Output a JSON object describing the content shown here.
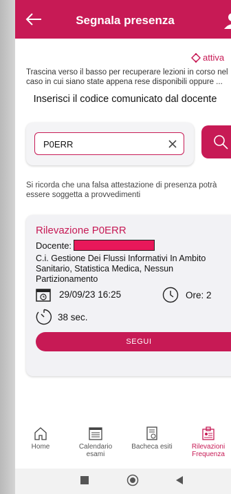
{
  "header": {
    "title": "Segnala presenza"
  },
  "attiva_label": "attiva",
  "info_line1": "Trascina verso il basso per recuperare lezioni in corso nel",
  "info_line2": "caso in cui siano state appena rese disponibili oppure ...",
  "code_heading": "Inserisci il codice comunicato dal docente",
  "search": {
    "value": "P0ERR"
  },
  "warning": "Si ricorda che una falsa attestazione di presenza potrà essere soggetta a provvedimenti",
  "card": {
    "title": "Rilevazione P0ERR",
    "docente_label": "Docente:",
    "course": "C.i. Gestione Dei Flussi Informativi In Ambito Sanitario, Statistica Medica, Nessun Partizionamento",
    "datetime": "29/09/23 16:25",
    "hours": "Ore: 2",
    "duration": "38 sec.",
    "button": "SEGUI"
  },
  "nav": [
    {
      "label": "Home"
    },
    {
      "label": "Calendario esami"
    },
    {
      "label": "Bacheca esiti"
    },
    {
      "label": "Rilevazioni Frequenza"
    }
  ],
  "colors": {
    "accent": "#c71a55"
  }
}
